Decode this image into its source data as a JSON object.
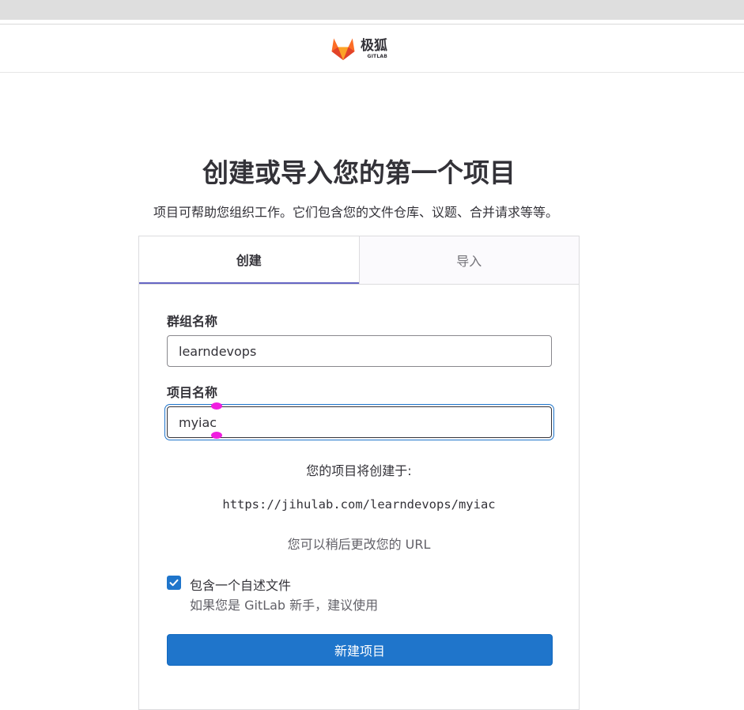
{
  "brand": {
    "name_cn": "极狐",
    "name_en": "GITLAB",
    "colors": {
      "orange": "#fc6d26",
      "orange_light": "#fca326",
      "red": "#e24329"
    }
  },
  "page": {
    "title": "创建或导入您的第一个项目",
    "subtitle": "项目可帮助您组织工作。它们包含您的文件仓库、议题、合并请求等等。"
  },
  "tabs": [
    {
      "label": "创建",
      "active": true
    },
    {
      "label": "导入",
      "active": false
    }
  ],
  "form": {
    "group_label": "群组名称",
    "group_value": "learndevops",
    "project_label": "项目名称",
    "project_value": "myiac",
    "url_caption": "您的项目将创建于:",
    "url_value": "https://jihulab.com/learndevops/myiac",
    "url_note": "您可以稍后更改您的 URL",
    "readme_checked": true,
    "readme_label": "包含一个自述文件",
    "readme_help": "如果您是 GitLab 新手，建议使用",
    "submit_label": "新建项目"
  },
  "colors": {
    "accent_blue": "#1f75cb",
    "tab_underline": "#6666c4",
    "text": "#333238"
  }
}
